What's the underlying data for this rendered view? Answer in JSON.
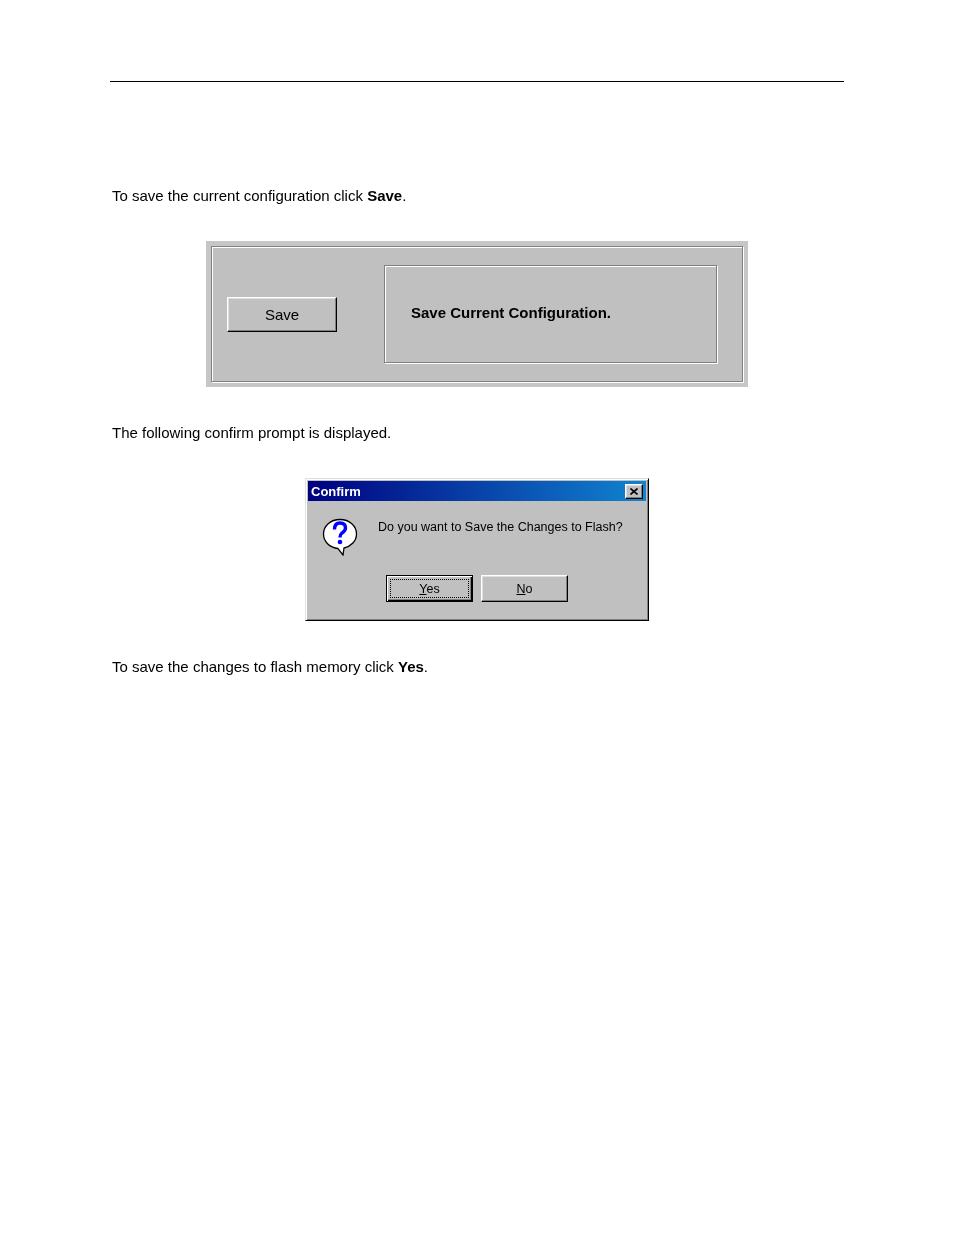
{
  "intro_text": "To save the current configuration click **Save**.",
  "save_panel": {
    "button": "Save",
    "description": "Save Current Configuration."
  },
  "prompt_text": "The following confirm prompt is displayed.",
  "confirm_dialog": {
    "title": "Confirm",
    "message": "Do you want to Save the Changes to Flash?",
    "buttons": [
      {
        "label": "Yes",
        "focused": true,
        "mnemonic_underlined": true
      },
      {
        "label": "No",
        "focused": false,
        "mnemonic_underlined": true
      }
    ]
  },
  "closing_text": "To save the changes to flash memory click **Yes**."
}
